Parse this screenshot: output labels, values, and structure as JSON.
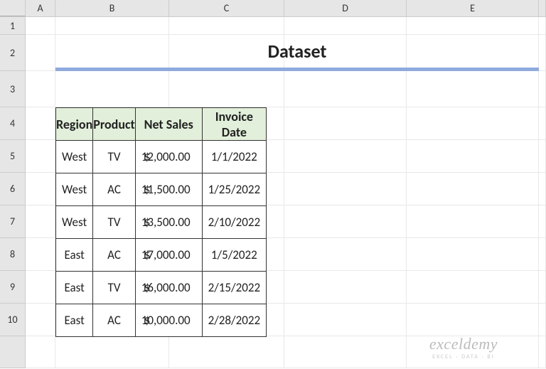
{
  "columns": [
    "A",
    "B",
    "C",
    "D",
    "E"
  ],
  "rows": [
    "1",
    "2",
    "3",
    "4",
    "5",
    "6",
    "7",
    "8",
    "9",
    "10"
  ],
  "title": "Dataset",
  "headers": {
    "region": "Region",
    "product": "Product",
    "net_sales": "Net Sales",
    "invoice_date": "Invoice Date"
  },
  "data": [
    {
      "region": "West",
      "product": "TV",
      "sales": "12,000.00",
      "date": "1/1/2022"
    },
    {
      "region": "West",
      "product": "AC",
      "sales": "11,500.00",
      "date": "1/25/2022"
    },
    {
      "region": "West",
      "product": "TV",
      "sales": "13,500.00",
      "date": "2/10/2022"
    },
    {
      "region": "East",
      "product": "AC",
      "sales": "17,000.00",
      "date": "1/5/2022"
    },
    {
      "region": "East",
      "product": "TV",
      "sales": "16,000.00",
      "date": "2/15/2022"
    },
    {
      "region": "East",
      "product": "AC",
      "sales": "10,000.00",
      "date": "2/28/2022"
    }
  ],
  "currency": "$",
  "watermark": {
    "title": "exceldemy",
    "sub": "EXCEL · DATA · BI"
  }
}
